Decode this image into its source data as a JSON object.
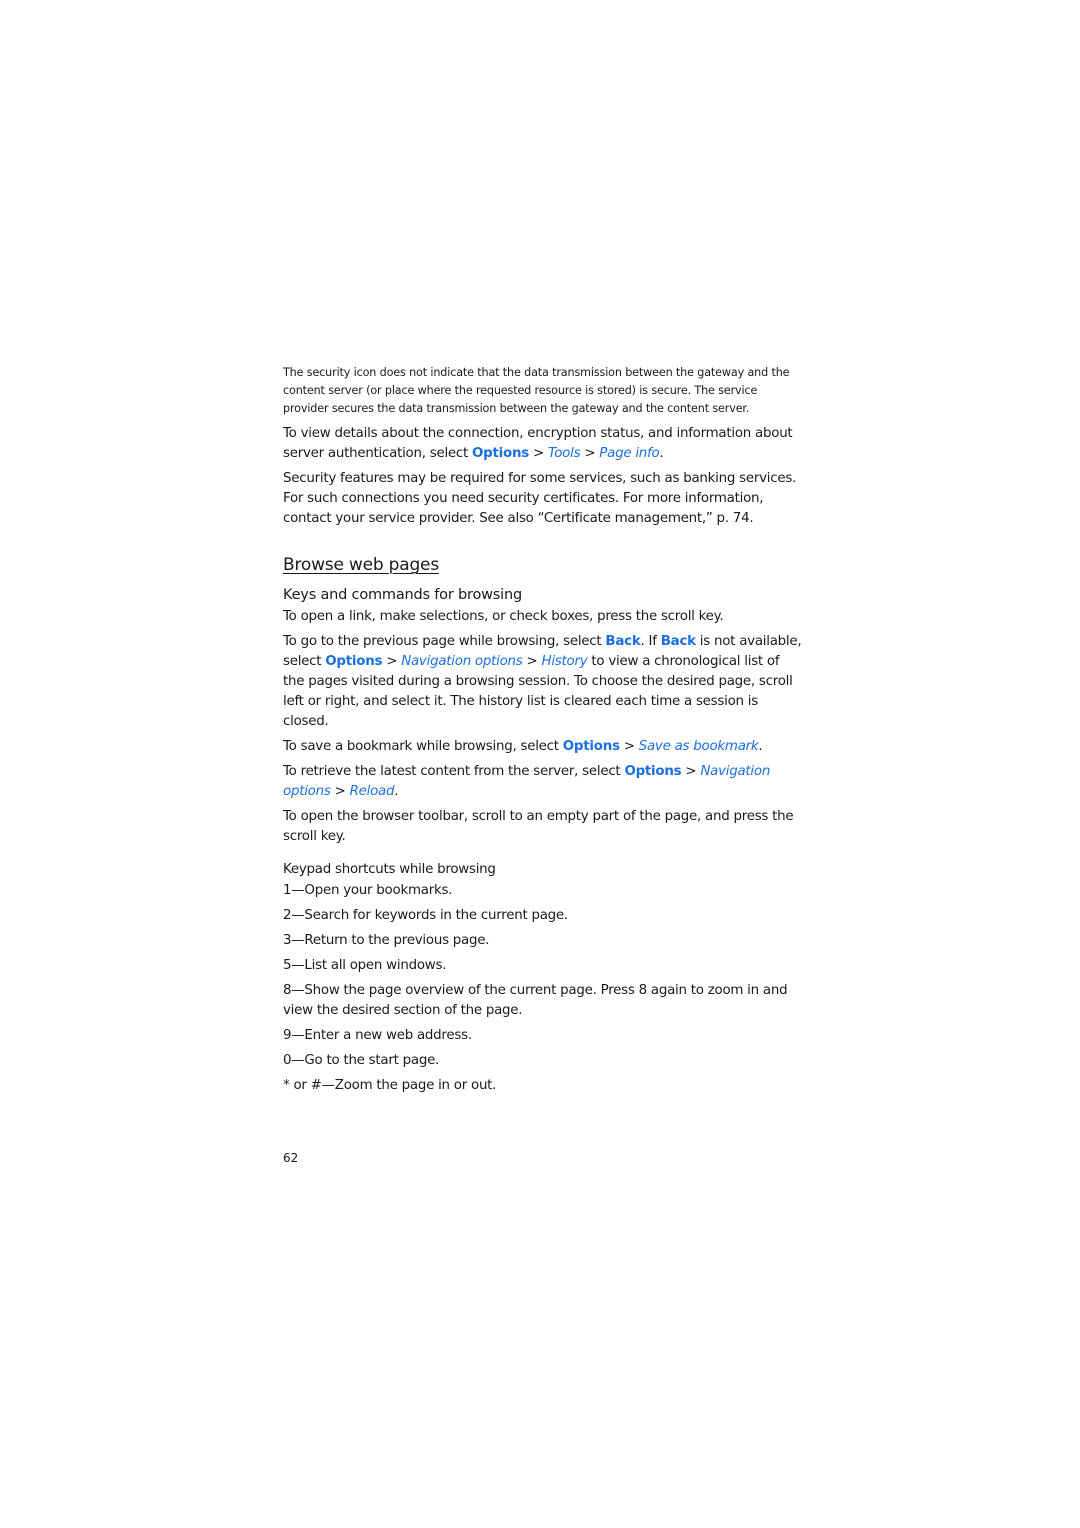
{
  "security_note": "The security icon does not indicate that the data transmission between the gateway and the content server (or place where the requested resource is stored) is secure. The service provider secures the data transmission between the gateway and the content server.",
  "page_info_para": {
    "text_before": "To view details about the connection, encryption status, and information about server authentication, select ",
    "options": "Options",
    "sep": " > ",
    "tools": "Tools",
    "page_info": "Page info",
    "end": "."
  },
  "security_features_para": "Security features may be required for some services, such as banking services. For such connections you need security certificates. For more information, contact your service provider. See also “Certificate management,” p. 74.",
  "section_title": "Browse web pages",
  "subsection_title": "Keys and commands for browsing",
  "open_link_para": "To open a link, make selections, or check boxes, press the scroll key.",
  "previous_page_para": {
    "t1": "To go to the previous page while browsing, select ",
    "back": "Back",
    "t2": ". If ",
    "t3": " is not available, select ",
    "options": "Options",
    "sep": " > ",
    "navigation_options": "Navigation options",
    "history": "History",
    "t4": " to view a chronological list of the pages visited during a browsing session. To choose the desired page, scroll left or right, and select it. The history list is cleared each time a session is closed."
  },
  "bookmark_para": {
    "t1": "To save a bookmark while browsing, select ",
    "options": "Options",
    "sep": " > ",
    "save_as_bookmark": "Save as bookmark",
    "end": "."
  },
  "reload_para": {
    "t1": "To retrieve the latest content from the server, select ",
    "options": "Options",
    "sep": " > ",
    "navigation_options": "Navigation options",
    "reload": "Reload",
    "end": "."
  },
  "toolbar_para": "To open the browser toolbar, scroll to an empty part of the page, and press the scroll key.",
  "shortcuts_title": "Keypad shortcuts while browsing",
  "shortcuts": [
    {
      "key": "1",
      "text": "—Open your bookmarks."
    },
    {
      "key": "2",
      "text": "—Search for keywords in the current page."
    },
    {
      "key": "3",
      "text": "—Return to the previous page."
    },
    {
      "key": "5",
      "text": "—List all open windows."
    },
    {
      "key": "8",
      "text": "—Show the page overview of the current page. Press ",
      "key2": "8",
      "text2": " again to zoom in and view the desired section of the page."
    },
    {
      "key": "9",
      "text": "—Enter a new web address."
    },
    {
      "key": "0",
      "text": "—Go to the start page."
    },
    {
      "key": "*",
      "mid": " or ",
      "key2": "#",
      "text": "—Zoom the page in or out."
    }
  ],
  "page_number": "62",
  "colors": {
    "link": "#1c6fe0",
    "text": "#1a1a1a",
    "background": "#ffffff"
  }
}
